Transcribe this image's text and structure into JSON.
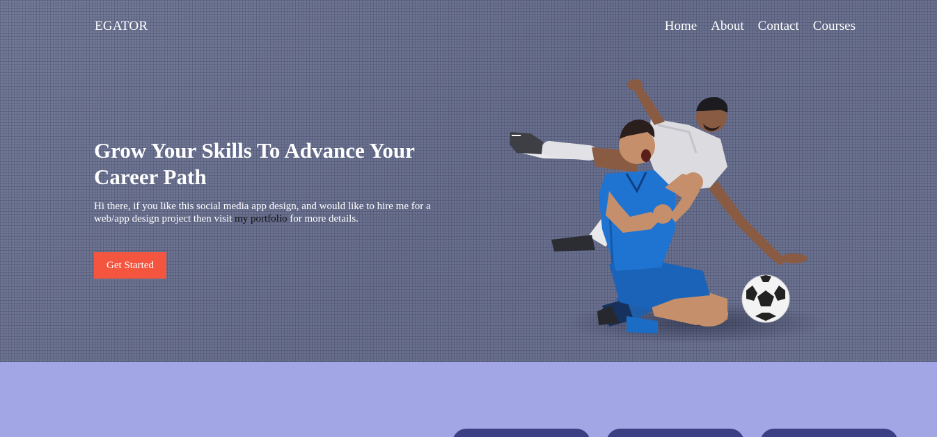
{
  "brand": {
    "logo": "EGATOR"
  },
  "nav": {
    "items": [
      {
        "label": "Home"
      },
      {
        "label": "About"
      },
      {
        "label": "Contact"
      },
      {
        "label": "Courses"
      }
    ]
  },
  "hero": {
    "headline": "Grow Your Skills To Advance Your Career Path",
    "description_before": "Hi there, if you like this social media app design, and would like to hire me for a web/app design project then visit ",
    "portfolio_link": "my portfolio",
    "description_after": " for more details.",
    "cta_label": "Get Started",
    "image_alt": "soccer-players-illustration"
  },
  "colors": {
    "hero_bg": "#6f7694",
    "cta": "#f4553f",
    "section2_bg": "#a3a6e4",
    "pill": "#3b3f83"
  }
}
